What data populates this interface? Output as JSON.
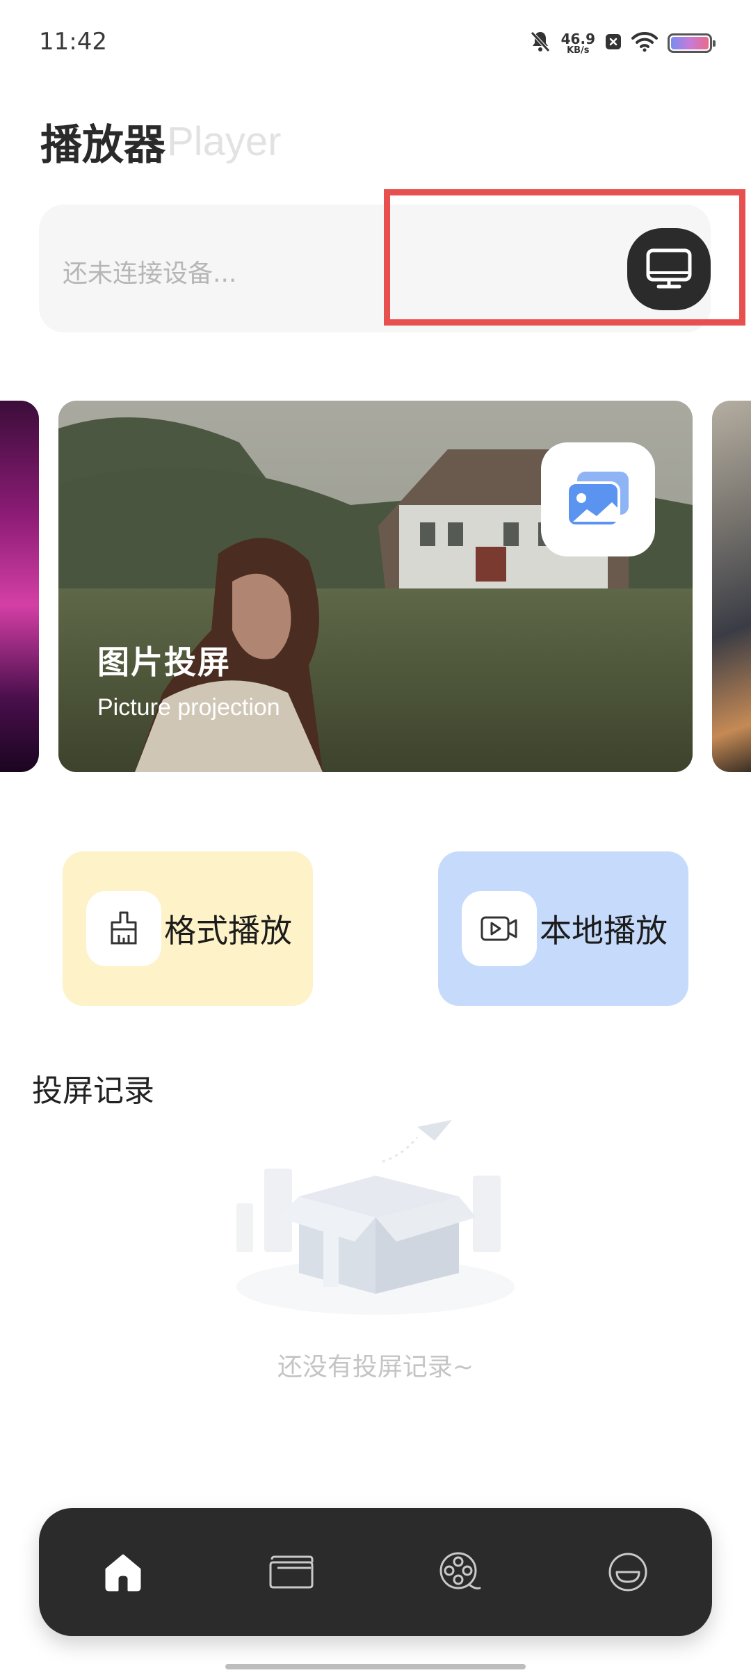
{
  "status_bar": {
    "time": "11:42",
    "net_speed_value": "46.9",
    "net_speed_unit": "KB/s",
    "icons": [
      "mute-bell-icon",
      "x-box-icon",
      "wifi-icon",
      "battery-icon"
    ]
  },
  "header": {
    "title": "播放器",
    "subtitle": "Player"
  },
  "device": {
    "status_text": "还未连接设备...",
    "button_icon": "monitor-icon"
  },
  "carousel": {
    "active_title": "图片投屏",
    "active_subtitle": "Picture projection",
    "active_icon": "picture-icon"
  },
  "actions": [
    {
      "label": "格式播放",
      "icon": "brush-icon",
      "color": "#fdf2c8"
    },
    {
      "label": "本地播放",
      "icon": "video-play-icon",
      "color": "#c6dbfb"
    }
  ],
  "records": {
    "title": "投屏记录",
    "empty_text": "还没有投屏记录~"
  },
  "bottom_nav": {
    "items": [
      "home-icon",
      "folder-icon",
      "film-reel-icon",
      "smile-face-icon"
    ],
    "active": "home-icon"
  },
  "colors": {
    "accent_dark": "#2b2b2b",
    "highlight_red": "#e84f4f"
  }
}
